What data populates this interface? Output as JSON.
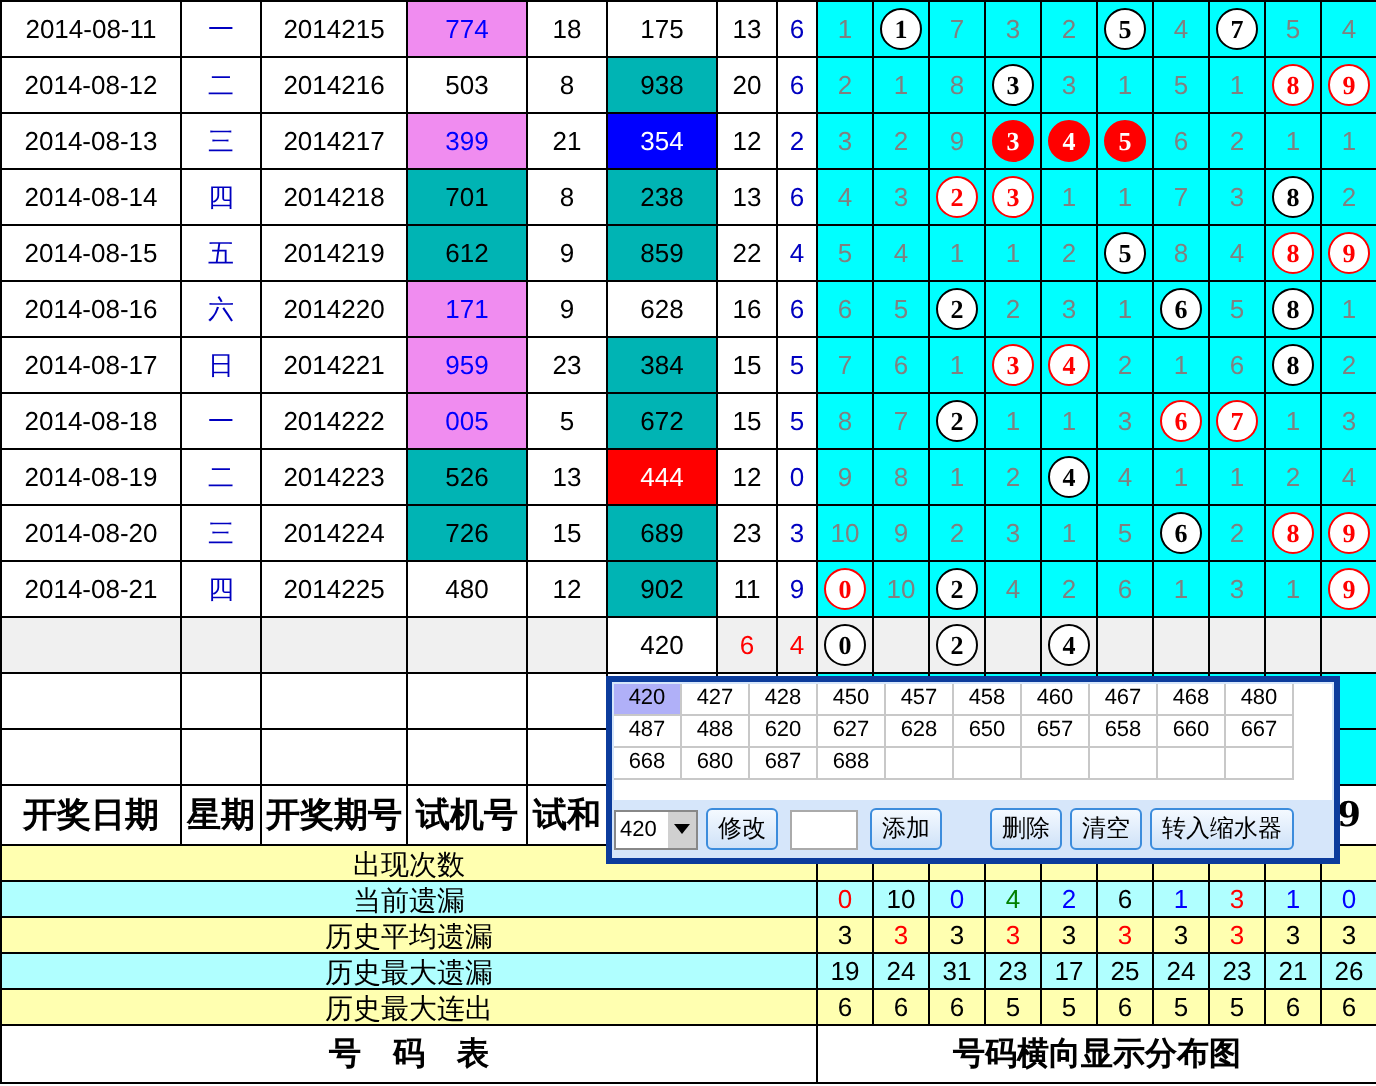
{
  "rows": [
    {
      "date": "2014-08-11",
      "weekday": "一",
      "issue": "2014215",
      "trial": {
        "text": "774",
        "color": "#f08cf0"
      },
      "trial_sum": "18",
      "draw": {
        "text": "175",
        "color": "#ffffff"
      },
      "sum": "13",
      "span": "6",
      "digits": [
        {
          "text": "1",
          "kind": "plain"
        },
        {
          "text": "1",
          "kind": "ball"
        },
        {
          "text": "7",
          "kind": "plain"
        },
        {
          "text": "3",
          "kind": "plain"
        },
        {
          "text": "2",
          "kind": "plain"
        },
        {
          "text": "5",
          "kind": "ball"
        },
        {
          "text": "4",
          "kind": "plain"
        },
        {
          "text": "7",
          "kind": "ball"
        },
        {
          "text": "5",
          "kind": "plain"
        },
        {
          "text": "4",
          "kind": "plain"
        }
      ]
    },
    {
      "date": "2014-08-12",
      "weekday": "二",
      "issue": "2014216",
      "trial": {
        "text": "503",
        "color": "#ffffff"
      },
      "trial_sum": "8",
      "draw": {
        "text": "938",
        "color": "#00b4b4"
      },
      "sum": "20",
      "span": "6",
      "digits": [
        {
          "text": "2",
          "kind": "plain"
        },
        {
          "text": "1",
          "kind": "plain"
        },
        {
          "text": "8",
          "kind": "plain"
        },
        {
          "text": "3",
          "kind": "ball"
        },
        {
          "text": "3",
          "kind": "plain"
        },
        {
          "text": "1",
          "kind": "plain"
        },
        {
          "text": "5",
          "kind": "plain"
        },
        {
          "text": "1",
          "kind": "plain"
        },
        {
          "text": "8",
          "kind": "ring"
        },
        {
          "text": "9",
          "kind": "ring"
        }
      ]
    },
    {
      "date": "2014-08-13",
      "weekday": "三",
      "issue": "2014217",
      "trial": {
        "text": "399",
        "color": "#f08cf0"
      },
      "trial_sum": "21",
      "draw": {
        "text": "354",
        "color": "#0000ff"
      },
      "sum": "12",
      "span": "2",
      "digits": [
        {
          "text": "3",
          "kind": "plain"
        },
        {
          "text": "2",
          "kind": "plain"
        },
        {
          "text": "9",
          "kind": "plain"
        },
        {
          "text": "3",
          "kind": "solid"
        },
        {
          "text": "4",
          "kind": "solid"
        },
        {
          "text": "5",
          "kind": "solid"
        },
        {
          "text": "6",
          "kind": "plain"
        },
        {
          "text": "2",
          "kind": "plain"
        },
        {
          "text": "1",
          "kind": "plain"
        },
        {
          "text": "1",
          "kind": "plain"
        }
      ]
    },
    {
      "date": "2014-08-14",
      "weekday": "四",
      "issue": "2014218",
      "trial": {
        "text": "701",
        "color": "#00b4b4"
      },
      "trial_sum": "8",
      "draw": {
        "text": "238",
        "color": "#00b4b4"
      },
      "sum": "13",
      "span": "6",
      "digits": [
        {
          "text": "4",
          "kind": "plain"
        },
        {
          "text": "3",
          "kind": "plain"
        },
        {
          "text": "2",
          "kind": "ring"
        },
        {
          "text": "3",
          "kind": "ring"
        },
        {
          "text": "1",
          "kind": "plain"
        },
        {
          "text": "1",
          "kind": "plain"
        },
        {
          "text": "7",
          "kind": "plain"
        },
        {
          "text": "3",
          "kind": "plain"
        },
        {
          "text": "8",
          "kind": "ball"
        },
        {
          "text": "2",
          "kind": "plain"
        }
      ]
    },
    {
      "date": "2014-08-15",
      "weekday": "五",
      "issue": "2014219",
      "trial": {
        "text": "612",
        "color": "#00b4b4"
      },
      "trial_sum": "9",
      "draw": {
        "text": "859",
        "color": "#00b4b4"
      },
      "sum": "22",
      "span": "4",
      "digits": [
        {
          "text": "5",
          "kind": "plain"
        },
        {
          "text": "4",
          "kind": "plain"
        },
        {
          "text": "1",
          "kind": "plain"
        },
        {
          "text": "1",
          "kind": "plain"
        },
        {
          "text": "2",
          "kind": "plain"
        },
        {
          "text": "5",
          "kind": "ball"
        },
        {
          "text": "8",
          "kind": "plain"
        },
        {
          "text": "4",
          "kind": "plain"
        },
        {
          "text": "8",
          "kind": "ring"
        },
        {
          "text": "9",
          "kind": "ring"
        }
      ]
    },
    {
      "date": "2014-08-16",
      "weekday": "六",
      "issue": "2014220",
      "trial": {
        "text": "171",
        "color": "#f08cf0"
      },
      "trial_sum": "9",
      "draw": {
        "text": "628",
        "color": "#ffffff"
      },
      "sum": "16",
      "span": "6",
      "digits": [
        {
          "text": "6",
          "kind": "plain"
        },
        {
          "text": "5",
          "kind": "plain"
        },
        {
          "text": "2",
          "kind": "ball"
        },
        {
          "text": "2",
          "kind": "plain"
        },
        {
          "text": "3",
          "kind": "plain"
        },
        {
          "text": "1",
          "kind": "plain"
        },
        {
          "text": "6",
          "kind": "ball"
        },
        {
          "text": "5",
          "kind": "plain"
        },
        {
          "text": "8",
          "kind": "ball"
        },
        {
          "text": "1",
          "kind": "plain"
        }
      ]
    },
    {
      "date": "2014-08-17",
      "weekday": "日",
      "issue": "2014221",
      "trial": {
        "text": "959",
        "color": "#f08cf0"
      },
      "trial_sum": "23",
      "draw": {
        "text": "384",
        "color": "#00b4b4"
      },
      "sum": "15",
      "span": "5",
      "digits": [
        {
          "text": "7",
          "kind": "plain"
        },
        {
          "text": "6",
          "kind": "plain"
        },
        {
          "text": "1",
          "kind": "plain"
        },
        {
          "text": "3",
          "kind": "ring"
        },
        {
          "text": "4",
          "kind": "ring"
        },
        {
          "text": "2",
          "kind": "plain"
        },
        {
          "text": "1",
          "kind": "plain"
        },
        {
          "text": "6",
          "kind": "plain"
        },
        {
          "text": "8",
          "kind": "ball"
        },
        {
          "text": "2",
          "kind": "plain"
        }
      ]
    },
    {
      "date": "2014-08-18",
      "weekday": "一",
      "issue": "2014222",
      "trial": {
        "text": "005",
        "color": "#f08cf0"
      },
      "trial_sum": "5",
      "draw": {
        "text": "672",
        "color": "#00b4b4"
      },
      "sum": "15",
      "span": "5",
      "digits": [
        {
          "text": "8",
          "kind": "plain"
        },
        {
          "text": "7",
          "kind": "plain"
        },
        {
          "text": "2",
          "kind": "ball"
        },
        {
          "text": "1",
          "kind": "plain"
        },
        {
          "text": "1",
          "kind": "plain"
        },
        {
          "text": "3",
          "kind": "plain"
        },
        {
          "text": "6",
          "kind": "ring"
        },
        {
          "text": "7",
          "kind": "ring"
        },
        {
          "text": "1",
          "kind": "plain"
        },
        {
          "text": "3",
          "kind": "plain"
        }
      ]
    },
    {
      "date": "2014-08-19",
      "weekday": "二",
      "issue": "2014223",
      "trial": {
        "text": "526",
        "color": "#00b4b4"
      },
      "trial_sum": "13",
      "draw": {
        "text": "444",
        "color": "#ff0000"
      },
      "sum": "12",
      "span": "0",
      "digits": [
        {
          "text": "9",
          "kind": "plain"
        },
        {
          "text": "8",
          "kind": "plain"
        },
        {
          "text": "1",
          "kind": "plain"
        },
        {
          "text": "2",
          "kind": "plain"
        },
        {
          "text": "4",
          "kind": "ball"
        },
        {
          "text": "4",
          "kind": "plain"
        },
        {
          "text": "1",
          "kind": "plain"
        },
        {
          "text": "1",
          "kind": "plain"
        },
        {
          "text": "2",
          "kind": "plain"
        },
        {
          "text": "4",
          "kind": "plain"
        }
      ]
    },
    {
      "date": "2014-08-20",
      "weekday": "三",
      "issue": "2014224",
      "trial": {
        "text": "726",
        "color": "#00b4b4"
      },
      "trial_sum": "15",
      "draw": {
        "text": "689",
        "color": "#00b4b4"
      },
      "sum": "23",
      "span": "3",
      "digits": [
        {
          "text": "10",
          "kind": "plain"
        },
        {
          "text": "9",
          "kind": "plain"
        },
        {
          "text": "2",
          "kind": "plain"
        },
        {
          "text": "3",
          "kind": "plain"
        },
        {
          "text": "1",
          "kind": "plain"
        },
        {
          "text": "5",
          "kind": "plain"
        },
        {
          "text": "6",
          "kind": "ball"
        },
        {
          "text": "2",
          "kind": "plain"
        },
        {
          "text": "8",
          "kind": "ring"
        },
        {
          "text": "9",
          "kind": "ring"
        }
      ]
    },
    {
      "date": "2014-08-21",
      "weekday": "四",
      "issue": "2014225",
      "trial": {
        "text": "480",
        "color": "#ffffff"
      },
      "trial_sum": "12",
      "draw": {
        "text": "902",
        "color": "#00b4b4"
      },
      "sum": "11",
      "span": "9",
      "digits": [
        {
          "text": "0",
          "kind": "ring"
        },
        {
          "text": "10",
          "kind": "plain"
        },
        {
          "text": "2",
          "kind": "ball"
        },
        {
          "text": "4",
          "kind": "plain"
        },
        {
          "text": "2",
          "kind": "plain"
        },
        {
          "text": "6",
          "kind": "plain"
        },
        {
          "text": "1",
          "kind": "plain"
        },
        {
          "text": "3",
          "kind": "plain"
        },
        {
          "text": "1",
          "kind": "plain"
        },
        {
          "text": "9",
          "kind": "ring"
        }
      ]
    }
  ],
  "trial_row": {
    "draw": "420",
    "sum": "6",
    "span": "4",
    "digits": [
      {
        "text": "0",
        "kind": "ball"
      },
      {
        "kind": "empty"
      },
      {
        "text": "2",
        "kind": "ball"
      },
      {
        "kind": "empty"
      },
      {
        "text": "4",
        "kind": "ball"
      },
      {
        "kind": "empty"
      },
      {
        "kind": "empty"
      },
      {
        "kind": "empty"
      },
      {
        "kind": "empty"
      },
      {
        "kind": "empty"
      }
    ]
  },
  "headers": [
    "开奖日期",
    "星期",
    "开奖期号",
    "试机号",
    "试和"
  ],
  "digit_header_last": "9",
  "stats": [
    {
      "label": "出现次数"
    },
    {
      "label": "当前遗漏",
      "values": [
        {
          "text": "0",
          "color": "#ff0000"
        },
        {
          "text": "10",
          "color": "#000000"
        },
        {
          "text": "0",
          "color": "#0000ff"
        },
        {
          "text": "4",
          "color": "#008000"
        },
        {
          "text": "2",
          "color": "#0000ff"
        },
        {
          "text": "6",
          "color": "#000000"
        },
        {
          "text": "1",
          "color": "#0000ff"
        },
        {
          "text": "3",
          "color": "#ff0000"
        },
        {
          "text": "1",
          "color": "#0000ff"
        },
        {
          "text": "0",
          "color": "#0000ff"
        }
      ]
    },
    {
      "label": "历史平均遗漏",
      "values": [
        {
          "text": "3",
          "color": "#000000"
        },
        {
          "text": "3",
          "color": "#ff0000"
        },
        {
          "text": "3",
          "color": "#000000"
        },
        {
          "text": "3",
          "color": "#ff0000"
        },
        {
          "text": "3",
          "color": "#000000"
        },
        {
          "text": "3",
          "color": "#ff0000"
        },
        {
          "text": "3",
          "color": "#000000"
        },
        {
          "text": "3",
          "color": "#ff0000"
        },
        {
          "text": "3",
          "color": "#000000"
        },
        {
          "text": "3",
          "color": "#000000"
        }
      ]
    },
    {
      "label": "历史最大遗漏",
      "values": [
        {
          "text": "19",
          "color": "#000000"
        },
        {
          "text": "24",
          "color": "#000000"
        },
        {
          "text": "31",
          "color": "#000000"
        },
        {
          "text": "23",
          "color": "#000000"
        },
        {
          "text": "17",
          "color": "#000000"
        },
        {
          "text": "25",
          "color": "#000000"
        },
        {
          "text": "24",
          "color": "#000000"
        },
        {
          "text": "23",
          "color": "#000000"
        },
        {
          "text": "21",
          "color": "#000000"
        },
        {
          "text": "26",
          "color": "#000000"
        }
      ]
    },
    {
      "label": "历史最大连出",
      "values": [
        {
          "text": "6",
          "color": "#000000"
        },
        {
          "text": "6",
          "color": "#000000"
        },
        {
          "text": "6",
          "color": "#000000"
        },
        {
          "text": "5",
          "color": "#000000"
        },
        {
          "text": "5",
          "color": "#000000"
        },
        {
          "text": "6",
          "color": "#000000"
        },
        {
          "text": "5",
          "color": "#000000"
        },
        {
          "text": "5",
          "color": "#000000"
        },
        {
          "text": "6",
          "color": "#000000"
        },
        {
          "text": "6",
          "color": "#000000"
        }
      ]
    }
  ],
  "footer": [
    "号　码　表",
    "号码横向显示分布图"
  ],
  "popup": {
    "options": [
      {
        "text": "420",
        "selected": true
      },
      {
        "text": "427",
        "selected": false
      },
      {
        "text": "428",
        "selected": false
      },
      {
        "text": "450",
        "selected": false
      },
      {
        "text": "457",
        "selected": false
      },
      {
        "text": "458",
        "selected": false
      },
      {
        "text": "460",
        "selected": false
      },
      {
        "text": "467",
        "selected": false
      },
      {
        "text": "468",
        "selected": false
      },
      {
        "text": "480",
        "selected": false
      },
      {
        "text": "487",
        "selected": false
      },
      {
        "text": "488",
        "selected": false
      },
      {
        "text": "620",
        "selected": false
      },
      {
        "text": "627",
        "selected": false
      },
      {
        "text": "628",
        "selected": false
      },
      {
        "text": "650",
        "selected": false
      },
      {
        "text": "657",
        "selected": false
      },
      {
        "text": "658",
        "selected": false
      },
      {
        "text": "660",
        "selected": false
      },
      {
        "text": "667",
        "selected": false
      },
      {
        "text": "668",
        "selected": false
      },
      {
        "text": "680",
        "selected": false
      },
      {
        "text": "687",
        "selected": false
      },
      {
        "text": "688",
        "selected": false
      }
    ],
    "combo": "420",
    "edit_button": "修改",
    "add_button": "添加",
    "buttons": [
      "删除",
      "清空",
      "转入缩水器"
    ]
  }
}
